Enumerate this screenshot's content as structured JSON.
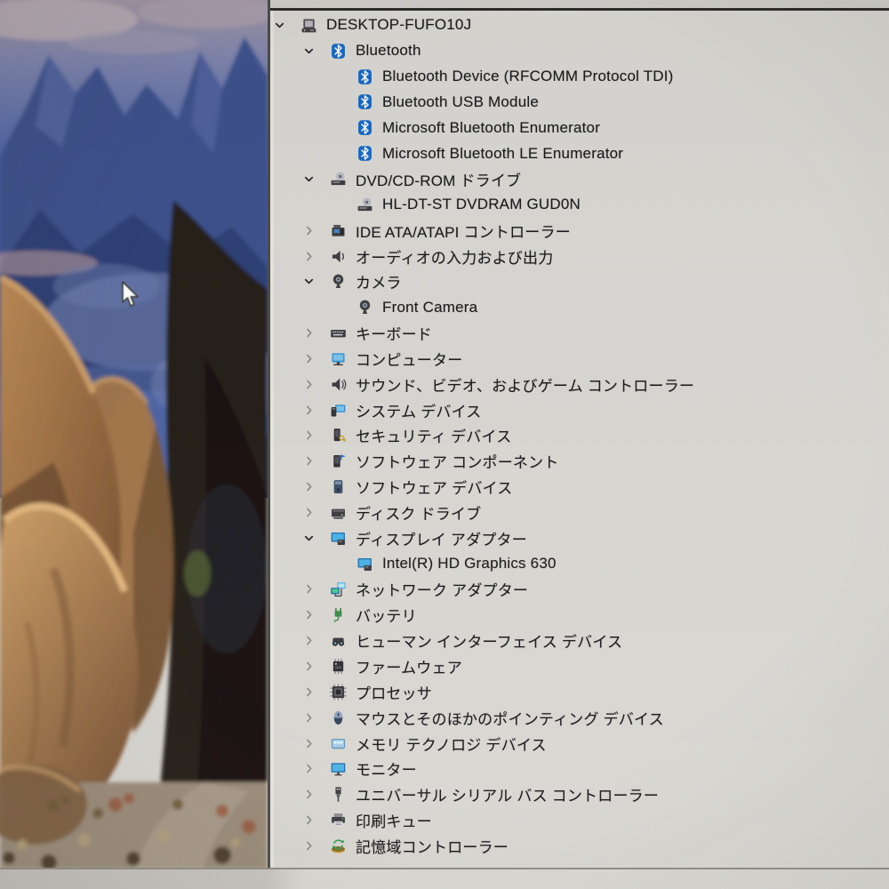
{
  "window": {
    "app": "Device Manager device tree",
    "computer_name": "DESKTOP-FUFO10J"
  },
  "colors": {
    "panel_background": "#dbd9d4",
    "panel_border": "#4a4a46",
    "text": "#17171a",
    "chevron_expanded": "#26262a",
    "chevron_collapsed": "#85847f",
    "bluetooth_blue": "#1468c8",
    "monitor_blue": "#45b3e8",
    "battery_green": "#3c8a4c"
  },
  "cursor": {
    "type": "arrow-pointer"
  },
  "tree": {
    "items": [
      {
        "label": "DESKTOP-FUFO10J",
        "level": 0,
        "state": "expanded",
        "icon": "computer"
      },
      {
        "label": "Bluetooth",
        "level": 1,
        "state": "expanded",
        "icon": "bluetooth"
      },
      {
        "label": "Bluetooth Device (RFCOMM Protocol TDI)",
        "level": 2,
        "state": "leaf",
        "icon": "bluetooth"
      },
      {
        "label": "Bluetooth USB Module",
        "level": 2,
        "state": "leaf",
        "icon": "bluetooth"
      },
      {
        "label": "Microsoft Bluetooth Enumerator",
        "level": 2,
        "state": "leaf",
        "icon": "bluetooth"
      },
      {
        "label": "Microsoft Bluetooth LE Enumerator",
        "level": 2,
        "state": "leaf",
        "icon": "bluetooth"
      },
      {
        "label": "DVD/CD-ROM ドライブ",
        "level": 1,
        "state": "expanded",
        "icon": "dvd"
      },
      {
        "label": "HL-DT-ST DVDRAM GUD0N",
        "level": 2,
        "state": "leaf",
        "icon": "dvd"
      },
      {
        "label": "IDE ATA/ATAPI コントローラー",
        "level": 1,
        "state": "collapsed",
        "icon": "ide"
      },
      {
        "label": "オーディオの入力および出力",
        "level": 1,
        "state": "collapsed",
        "icon": "audio"
      },
      {
        "label": "カメラ",
        "level": 1,
        "state": "expanded",
        "icon": "camera"
      },
      {
        "label": "Front Camera",
        "level": 2,
        "state": "leaf",
        "icon": "camera"
      },
      {
        "label": "キーボード",
        "level": 1,
        "state": "collapsed",
        "icon": "keyboard"
      },
      {
        "label": "コンピューター",
        "level": 1,
        "state": "collapsed",
        "icon": "computer-blue"
      },
      {
        "label": "サウンド、ビデオ、およびゲーム コントローラー",
        "level": 1,
        "state": "collapsed",
        "icon": "sound"
      },
      {
        "label": "システム デバイス",
        "level": 1,
        "state": "collapsed",
        "icon": "system"
      },
      {
        "label": "セキュリティ デバイス",
        "level": 1,
        "state": "collapsed",
        "icon": "security"
      },
      {
        "label": "ソフトウェア コンポーネント",
        "level": 1,
        "state": "collapsed",
        "icon": "software-component"
      },
      {
        "label": "ソフトウェア デバイス",
        "level": 1,
        "state": "collapsed",
        "icon": "software-device"
      },
      {
        "label": "ディスク ドライブ",
        "level": 1,
        "state": "collapsed",
        "icon": "disk"
      },
      {
        "label": "ディスプレイ アダプター",
        "level": 1,
        "state": "expanded",
        "icon": "display"
      },
      {
        "label": "Intel(R) HD Graphics 630",
        "level": 2,
        "state": "leaf",
        "icon": "display"
      },
      {
        "label": "ネットワーク アダプター",
        "level": 1,
        "state": "collapsed",
        "icon": "network"
      },
      {
        "label": "バッテリ",
        "level": 1,
        "state": "collapsed",
        "icon": "battery"
      },
      {
        "label": "ヒューマン インターフェイス デバイス",
        "level": 1,
        "state": "collapsed",
        "icon": "hid"
      },
      {
        "label": "ファームウェア",
        "level": 1,
        "state": "collapsed",
        "icon": "firmware"
      },
      {
        "label": "プロセッサ",
        "level": 1,
        "state": "collapsed",
        "icon": "processor"
      },
      {
        "label": "マウスとそのほかのポインティング デバイス",
        "level": 1,
        "state": "collapsed",
        "icon": "mouse"
      },
      {
        "label": "メモリ テクノロジ デバイス",
        "level": 1,
        "state": "collapsed",
        "icon": "memory"
      },
      {
        "label": "モニター",
        "level": 1,
        "state": "collapsed",
        "icon": "monitor"
      },
      {
        "label": "ユニバーサル シリアル バス コントローラー",
        "level": 1,
        "state": "collapsed",
        "icon": "usb"
      },
      {
        "label": "印刷キュー",
        "level": 1,
        "state": "collapsed",
        "icon": "printer"
      },
      {
        "label": "記憶域コントローラー",
        "level": 1,
        "state": "collapsed",
        "icon": "storage"
      }
    ]
  }
}
